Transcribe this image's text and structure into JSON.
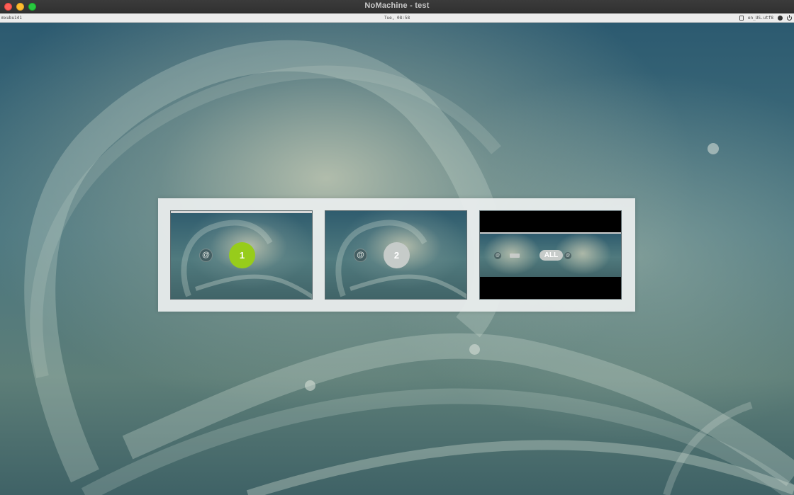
{
  "window": {
    "title": "NoMachine - test"
  },
  "panel": {
    "left_label": "mxubu141",
    "clock": "Tue, 08:58",
    "keyboard_layout": "en_US.utf8",
    "icons": [
      "document-icon",
      "accessibility-icon",
      "power-icon"
    ]
  },
  "display_selector": {
    "screens": [
      {
        "label": "1",
        "selected": true
      },
      {
        "label": "2",
        "selected": false
      },
      {
        "label": "ALL",
        "selected": false
      }
    ],
    "colors": {
      "selected": "#97cc1b",
      "unselected": "#c6cbc9"
    }
  }
}
